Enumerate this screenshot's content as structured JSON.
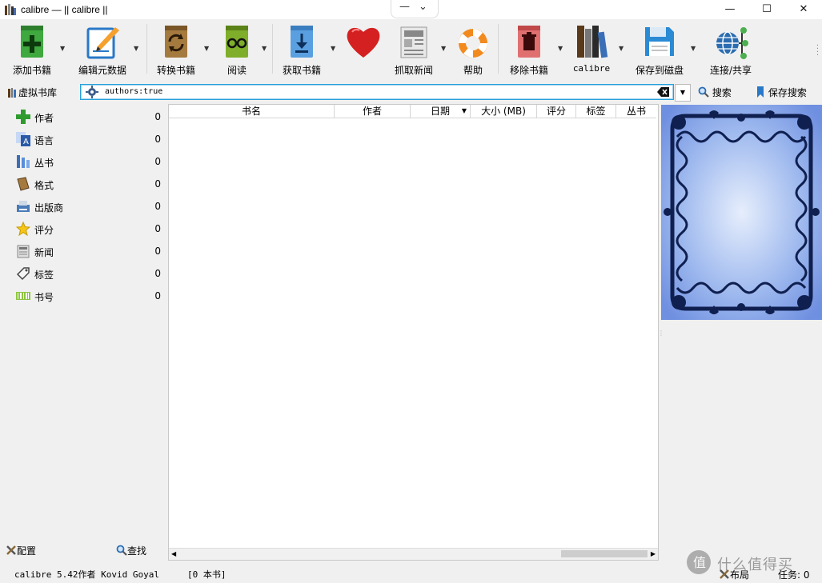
{
  "window": {
    "title": "calibre — || calibre ||",
    "minimize": "—",
    "maximize": "☐",
    "close": "✕",
    "mini_left": "—",
    "mini_right": "⌄"
  },
  "toolbar": {
    "add_books": "添加书籍",
    "edit_metadata": "编辑元数据",
    "convert_books": "转换书籍",
    "view": "阅读",
    "get_books": "获取书籍",
    "donate": "",
    "fetch_news": "抓取新闻",
    "help": "帮助",
    "remove_books": "移除书籍",
    "library": "calibre",
    "save_to_disk": "保存到磁盘",
    "connect_share": "连接/共享"
  },
  "search": {
    "virtual_library": "虚拟书库",
    "query": "authors:true",
    "search_label": "搜索",
    "saved_search_label": "保存搜索"
  },
  "tag_browser": {
    "categories": [
      {
        "name": "作者",
        "count": "0",
        "icon": "plus-icon"
      },
      {
        "name": "语言",
        "count": "0",
        "icon": "language-icon"
      },
      {
        "name": "丛书",
        "count": "0",
        "icon": "series-icon"
      },
      {
        "name": "格式",
        "count": "0",
        "icon": "book-icon"
      },
      {
        "name": "出版商",
        "count": "0",
        "icon": "publisher-icon"
      },
      {
        "name": "评分",
        "count": "0",
        "icon": "star-icon"
      },
      {
        "name": "新闻",
        "count": "0",
        "icon": "news-icon"
      },
      {
        "name": "标签",
        "count": "0",
        "icon": "tag-icon"
      },
      {
        "name": "书号",
        "count": "0",
        "icon": "barcode-icon"
      }
    ],
    "configure": "配置",
    "find": "查找"
  },
  "book_list": {
    "columns": [
      "书名",
      "作者",
      "日期",
      "大小 (MB)",
      "评分",
      "标签",
      "丛书"
    ],
    "rows": []
  },
  "status": {
    "version": "calibre 5.42作者 Kovid Goyal",
    "book_count": "[0 本书]",
    "layout": "布局",
    "jobs": "任务: 0"
  },
  "watermark": "什么值得买",
  "colors": {
    "accent": "#26a0da",
    "cover_bg": "#8fb1ee",
    "cover_ornament": "#0f1f4f"
  }
}
